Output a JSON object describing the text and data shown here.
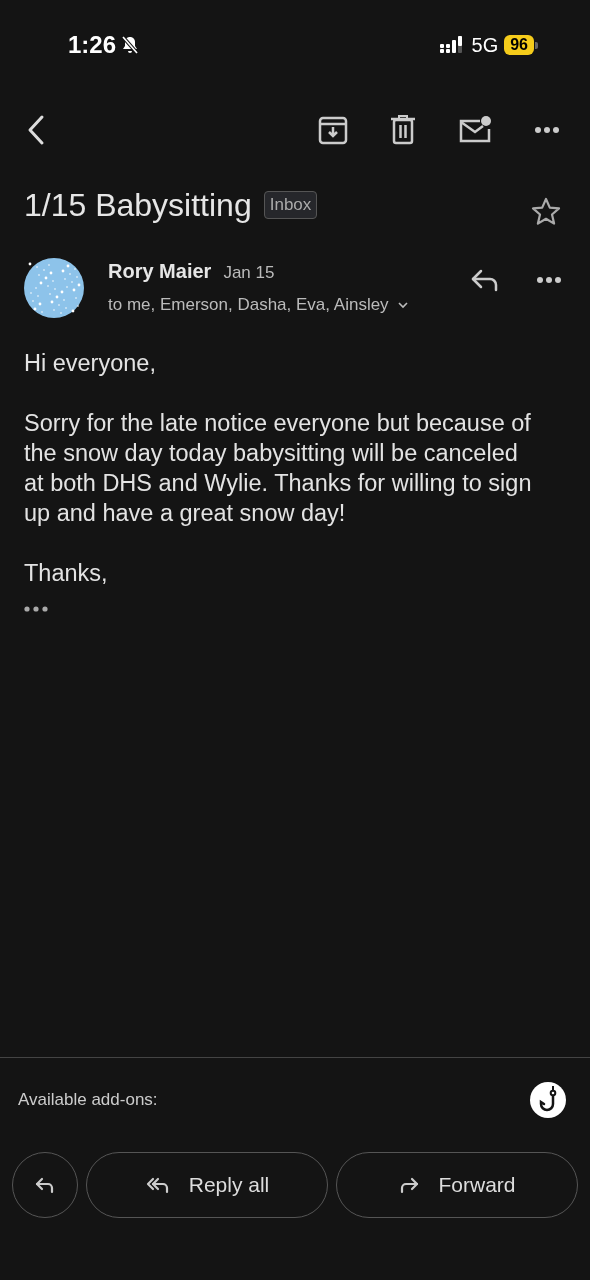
{
  "status_bar": {
    "time": "1:26",
    "network": "5G",
    "battery": "96"
  },
  "subject": "1/15 Babysitting",
  "label": "Inbox",
  "starred": false,
  "message": {
    "sender": "Rory Maier",
    "date": "Jan 15",
    "recipients": "to me, Emerson, Dasha, Eva, Ainsley",
    "body": [
      "Hi everyone,",
      "Sorry for the late notice everyone but because of the snow day today babysitting will be canceled at both DHS and Wylie. Thanks for willing to sign up and have a great snow day!",
      "Thanks,"
    ]
  },
  "addons": {
    "label": "Available add-ons:"
  },
  "actions": [
    {
      "kind": "reply"
    },
    {
      "kind": "reply_all",
      "label": "Reply all"
    },
    {
      "kind": "forward",
      "label": "Forward"
    }
  ]
}
